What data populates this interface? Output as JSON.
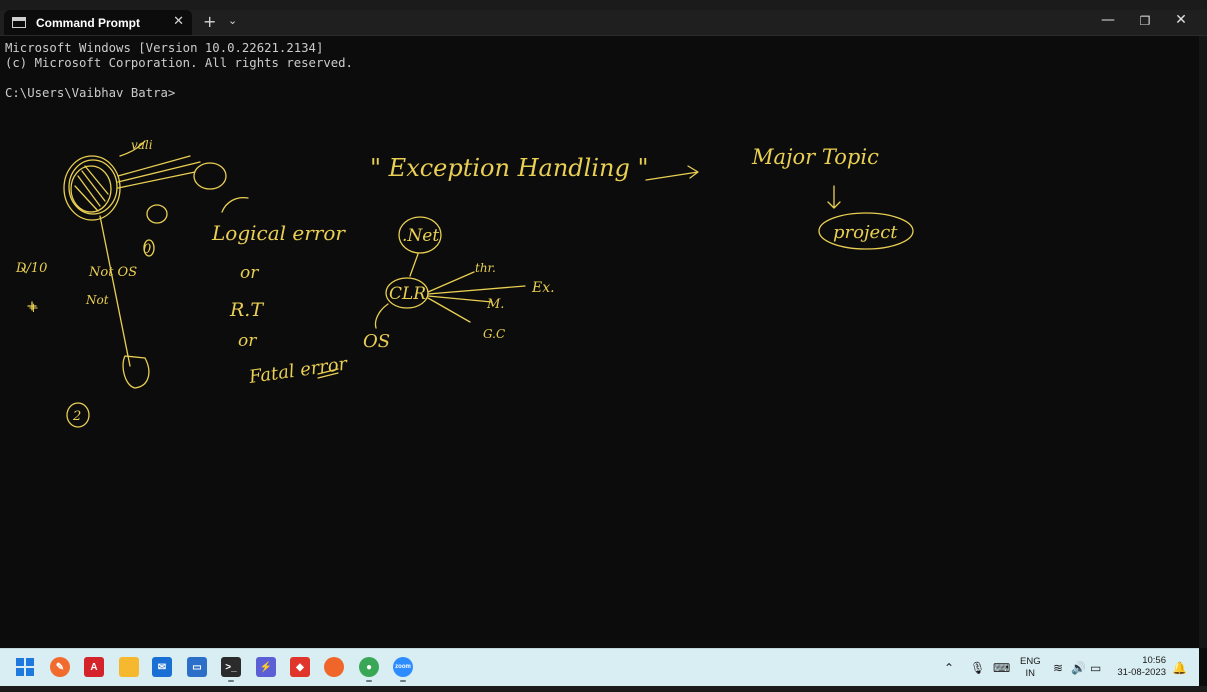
{
  "window": {
    "tab_title": "Command Prompt",
    "tab_close": "✕",
    "new_tab": "+",
    "tab_dropdown": "⌄",
    "minimize": "—",
    "maximize": "❐",
    "close": "✕"
  },
  "console": {
    "lines": [
      "Microsoft Windows [Version 10.0.22621.2134]",
      "(c) Microsoft Corporation. All rights reserved.",
      "",
      "C:\\Users\\Vaibhav Batra>"
    ]
  },
  "annotations": {
    "exception_handling": "\" Exception Handling \"",
    "major_topic": "Major Topic",
    "project": "project",
    "logical_error": "Logical error",
    "or1": "or",
    "rt": "R.T",
    "or2": "or",
    "fatal_error": "Fatal error",
    "net": ".Net",
    "clr": "CLR",
    "os": "OS",
    "thr": "thr.",
    "ex": "Ex.",
    "m": "M.",
    "gc": "G.C",
    "not_os": "Not OS",
    "not_1": "Not",
    "vali": "vali",
    "d10": "D/10",
    "circle_2": "2",
    "circle_0": "0",
    "plus": "+"
  },
  "taskbar": {
    "icons": [
      {
        "name": "start-icon",
        "color": "#1f7ae0"
      },
      {
        "name": "pen-app-icon",
        "color": "#f26b2e"
      },
      {
        "name": "pdf-reader-icon",
        "color": "#d4232b"
      },
      {
        "name": "file-explorer-icon",
        "color": "#f5b82e"
      },
      {
        "name": "mail-icon",
        "color": "#1a6fd4"
      },
      {
        "name": "whiteboard-icon",
        "color": "#2c6fc9"
      },
      {
        "name": "terminal-icon",
        "color": "#2b2b2b"
      },
      {
        "name": "power-automate-icon",
        "color": "#5b5fd6"
      },
      {
        "name": "anydesk-icon",
        "color": "#e0352b"
      },
      {
        "name": "firefox-icon",
        "color": "#f0662a"
      },
      {
        "name": "chrome-icon",
        "color": "#3aa757"
      },
      {
        "name": "zoom-icon",
        "color": "#2d8cff"
      }
    ],
    "zoom_label": "zoom",
    "lang_line1": "ENG",
    "lang_line2": "IN",
    "time": "10:56",
    "date": "31-08-2023"
  }
}
